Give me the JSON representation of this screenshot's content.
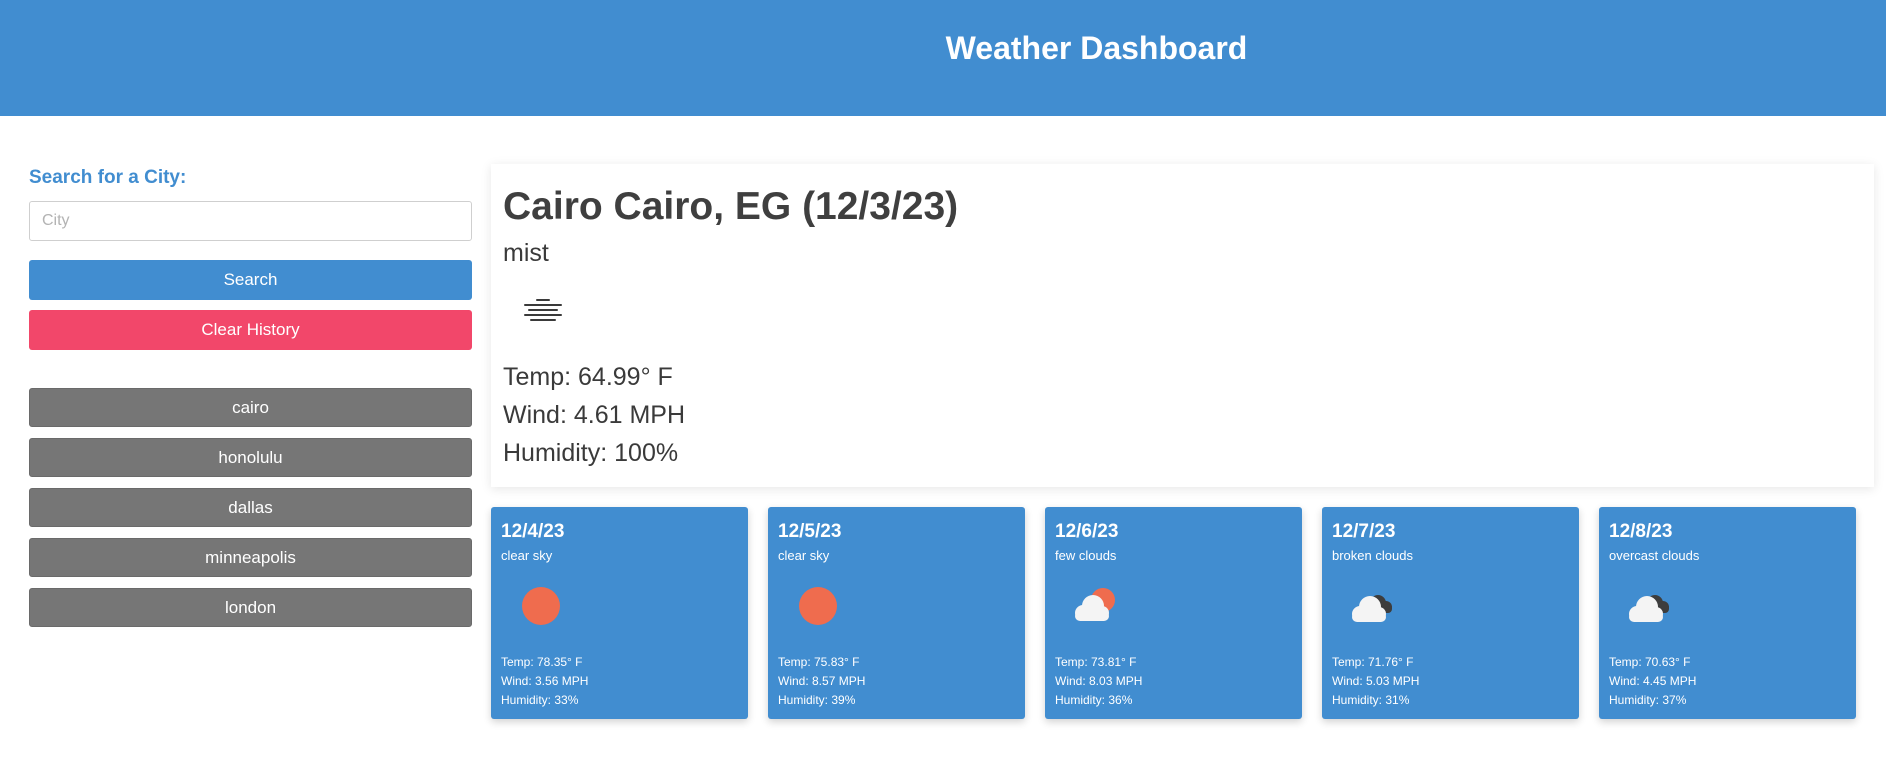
{
  "header": {
    "title": "Weather Dashboard"
  },
  "sidebar": {
    "search_label": "Search for a City:",
    "search_placeholder": "City",
    "search_value": "",
    "search_button": "Search",
    "clear_button": "Clear History",
    "history": [
      "cairo",
      "honolulu",
      "dallas",
      "minneapolis",
      "london"
    ]
  },
  "current": {
    "title": "Cairo Cairo, EG (12/3/23)",
    "description": "mist",
    "icon": "mist-icon",
    "temp": "Temp: 64.99° F",
    "wind": "Wind: 4.61 MPH",
    "humidity": "Humidity: 100%"
  },
  "forecast": [
    {
      "date": "12/4/23",
      "description": "clear sky",
      "icon": "sun-icon",
      "temp": "Temp: 78.35° F",
      "wind": "Wind: 3.56 MPH",
      "humidity": "Humidity: 33%"
    },
    {
      "date": "12/5/23",
      "description": "clear sky",
      "icon": "sun-icon",
      "temp": "Temp: 75.83° F",
      "wind": "Wind: 8.57 MPH",
      "humidity": "Humidity: 39%"
    },
    {
      "date": "12/6/23",
      "description": "few clouds",
      "icon": "few-clouds-icon",
      "temp": "Temp: 73.81° F",
      "wind": "Wind: 8.03 MPH",
      "humidity": "Humidity: 36%"
    },
    {
      "date": "12/7/23",
      "description": "broken clouds",
      "icon": "broken-clouds-icon",
      "temp": "Temp: 71.76° F",
      "wind": "Wind: 5.03 MPH",
      "humidity": "Humidity: 31%"
    },
    {
      "date": "12/8/23",
      "description": "overcast clouds",
      "icon": "overcast-clouds-icon",
      "temp": "Temp: 70.63° F",
      "wind": "Wind: 4.45 MPH",
      "humidity": "Humidity: 37%"
    }
  ],
  "colors": {
    "header_bg": "#418dd0",
    "clear_button": "#f2476a",
    "history_button": "#767676",
    "sun": "#ef6c4e"
  }
}
